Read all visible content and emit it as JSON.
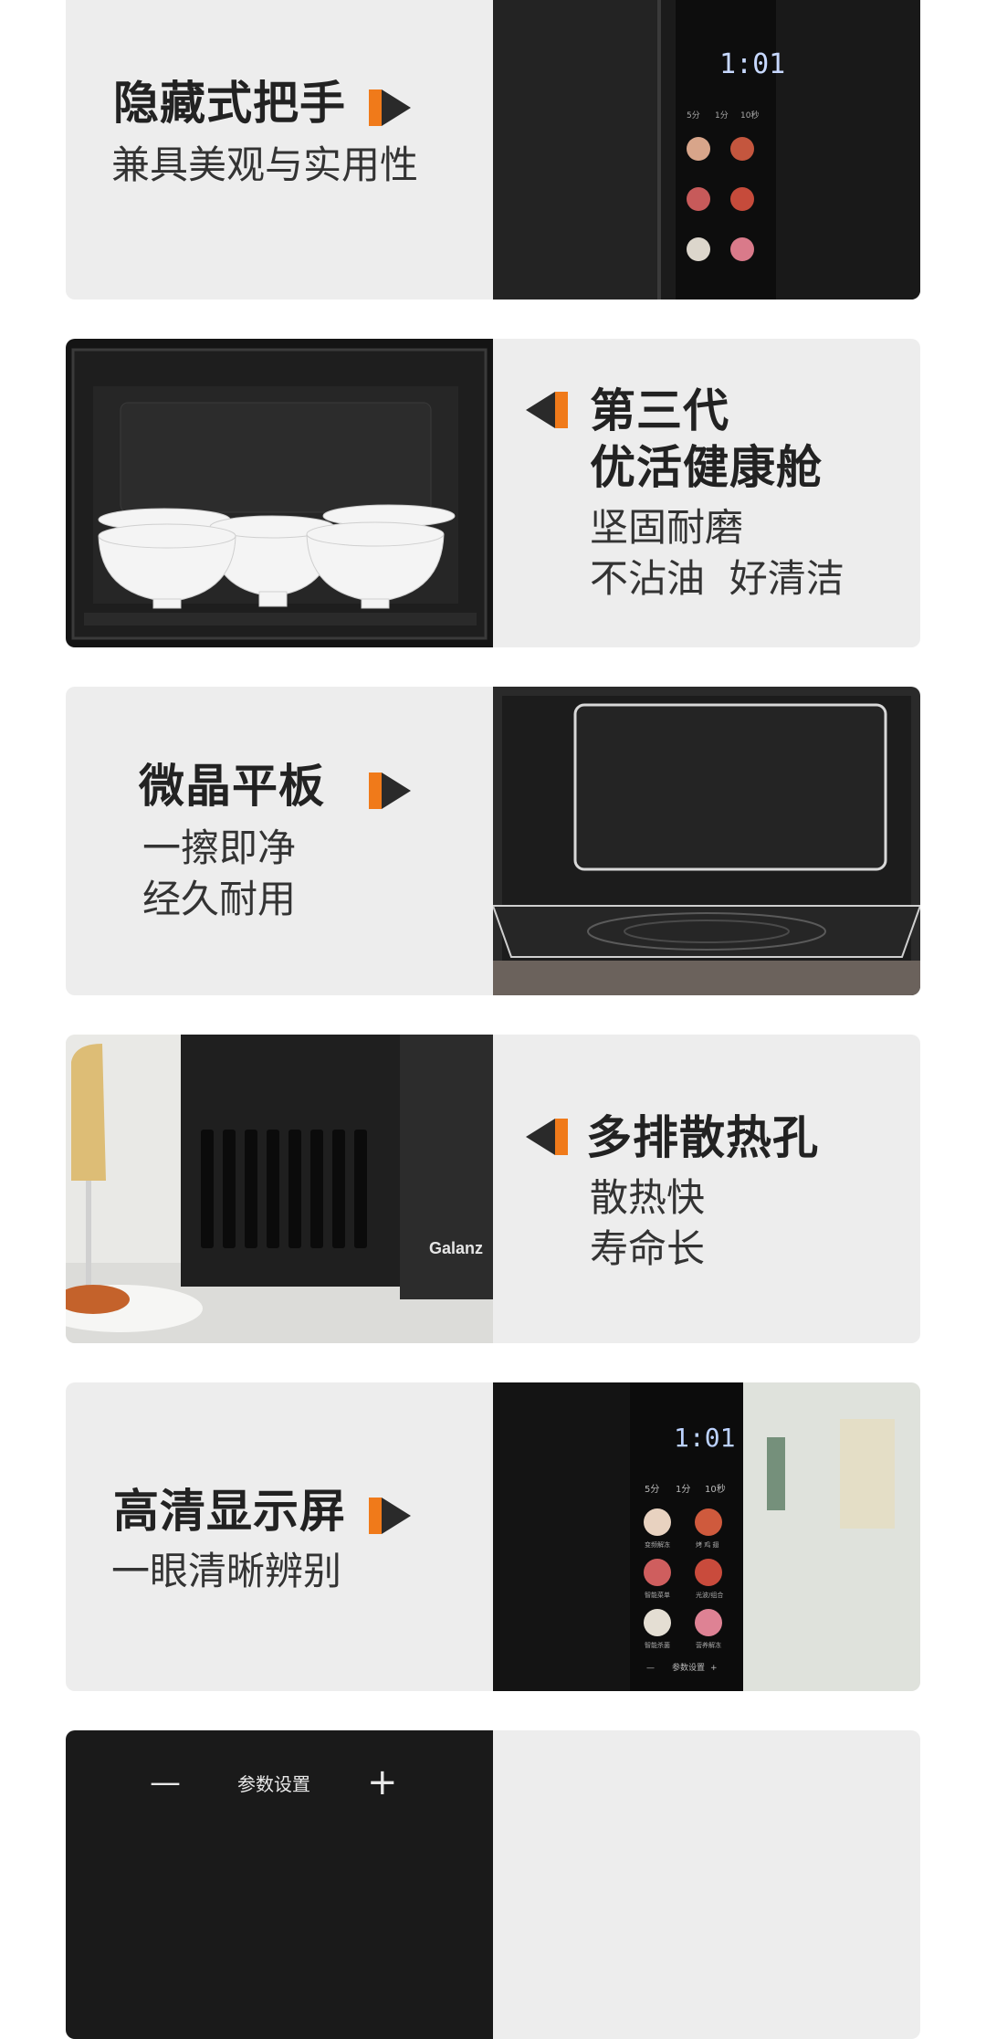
{
  "sections": [
    {
      "title": "隐藏式把手",
      "lines": [
        "兼具美观与实用性"
      ]
    },
    {
      "title_lines": [
        "第三代",
        "优活健康舱"
      ],
      "lines": [
        "坚固耐磨",
        "不沾油  好清洁"
      ]
    },
    {
      "title": "微晶平板",
      "lines": [
        "一擦即净",
        "经久耐用"
      ]
    },
    {
      "title": "多排散热孔",
      "lines": [
        "散热快",
        "寿命长"
      ]
    },
    {
      "title": "高清显示屏",
      "lines": [
        "一眼清晰辨别"
      ]
    },
    {
      "panel_label": "参数设置"
    }
  ],
  "display": {
    "digits": "1:01"
  },
  "panel": {
    "time_labels": [
      "5分",
      "1分",
      "10秒"
    ],
    "buttons": [
      "变频解冻",
      "烤 鸡 翅",
      "智能菜单",
      "光波/组合",
      "智能杀菌",
      "营养解冻"
    ],
    "bottom": [
      "—",
      "参数设置",
      "+"
    ]
  },
  "brand": "Galanz",
  "colors": {
    "accent": "#f07a1a",
    "dark": "#2a2a2a",
    "card_bg": "#ededed"
  }
}
